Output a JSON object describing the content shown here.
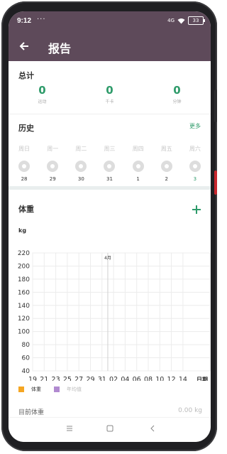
{
  "statusbar": {
    "time": "9:12",
    "dots": "···",
    "signal": "4G",
    "battery": "33"
  },
  "header": {
    "back_icon": "arrow-left-icon",
    "title": "报告"
  },
  "totals": {
    "title": "总计",
    "items": [
      {
        "value": "0",
        "label": "运动"
      },
      {
        "value": "0",
        "label": "千卡"
      },
      {
        "value": "0",
        "label": "分钟"
      }
    ]
  },
  "history": {
    "title": "历史",
    "more": "更多",
    "days": [
      {
        "weekday": "周日",
        "date": "28"
      },
      {
        "weekday": "周一",
        "date": "29"
      },
      {
        "weekday": "周二",
        "date": "30"
      },
      {
        "weekday": "周三",
        "date": "31"
      },
      {
        "weekday": "周四",
        "date": "1"
      },
      {
        "weekday": "周五",
        "date": "2"
      },
      {
        "weekday": "周六",
        "date": "3",
        "today": true
      }
    ]
  },
  "weight": {
    "title": "体重",
    "add_icon": "plus-icon",
    "unit": "kg",
    "legend": [
      {
        "label": "体重",
        "color": "#f5a623"
      },
      {
        "label": "年均值",
        "color": "#b18ad0"
      }
    ],
    "current_label": "目前体重",
    "current_value": "0.00 kg"
  },
  "chart_data": {
    "type": "line",
    "yunit": "kg",
    "ylim": [
      40,
      220
    ],
    "yticks": [
      "220",
      "200",
      "180",
      "160",
      "140",
      "120",
      "100",
      "80",
      "60",
      "40"
    ],
    "xticks": [
      "19",
      "21",
      "23",
      "25",
      "27",
      "29",
      "31",
      "02",
      "04",
      "06",
      "08",
      "10",
      "12",
      "14"
    ],
    "xlabel": "日期",
    "month_marker": "4月",
    "series": [
      {
        "name": "体重",
        "values": []
      },
      {
        "name": "年均值",
        "values": []
      }
    ],
    "grid": true
  },
  "colors": {
    "header": "#5e4a5a",
    "accent": "#2e9b6a"
  },
  "navbar": {
    "menu_icon": "menu-icon",
    "home_icon": "square-icon",
    "back_icon": "triangle-back-icon"
  }
}
